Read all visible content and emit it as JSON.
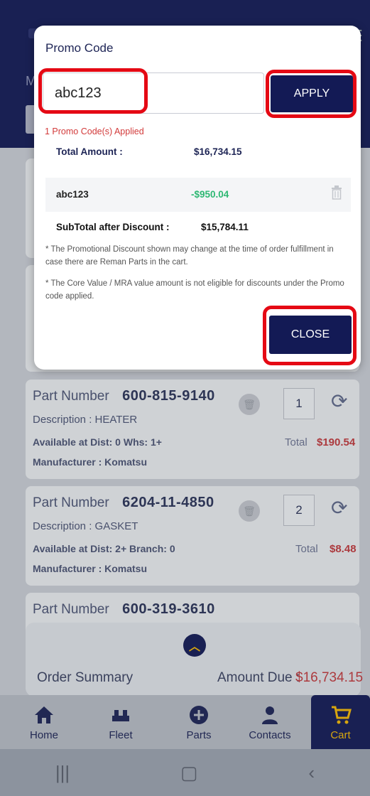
{
  "header": {
    "sub_letter": "M",
    "menu_icon": "hamburger-icon"
  },
  "parts": [
    {
      "pn_label": "Part Number",
      "pn": "600-815-9140",
      "desc": "Description :  HEATER",
      "avail": "Available at  Dist: 0  Whs: 1+",
      "mfr": "Manufacturer :  Komatsu",
      "qty": "1",
      "total_label": "Total",
      "total": "$190.54"
    },
    {
      "pn_label": "Part Number",
      "pn": "6204-11-4850",
      "desc": "Description :  GASKET",
      "avail": "Available at  Dist: 2+  Branch: 0",
      "mfr": "Manufacturer :  Komatsu",
      "qty": "2",
      "total_label": "Total",
      "total": "$8.48"
    },
    {
      "pn_label": "Part Number",
      "pn": "600-319-3610"
    }
  ],
  "summary": {
    "label": "Order Summary",
    "amount_due_label": "Amount Due :",
    "amount_due": "$16,734.15"
  },
  "nav": [
    {
      "label": "Home",
      "icon": "home-icon"
    },
    {
      "label": "Fleet",
      "icon": "fleet-icon"
    },
    {
      "label": "Parts",
      "icon": "plus-circle-icon"
    },
    {
      "label": "Contacts",
      "icon": "person-icon"
    },
    {
      "label": "Cart",
      "icon": "cart-icon"
    }
  ],
  "modal": {
    "title": "Promo Code",
    "promo_input_value": "abc123",
    "apply_label": "APPLY",
    "applied_msg": "1 Promo Code(s) Applied",
    "total_amount_label": "Total Amount :",
    "total_amount": "$16,734.15",
    "code": "abc123",
    "code_discount": "-$950.04",
    "subtotal_label": "SubTotal after Discount :",
    "subtotal": "$15,784.11",
    "note1": "* The Promotional Discount shown may change at the time of order fulfillment in case there are Reman Parts in the cart.",
    "note2": "* The Core Value / MRA value amount is not eligible for discounts under the Promo code applied.",
    "close_label": "CLOSE"
  },
  "colors": {
    "navy": "#131a55",
    "accent": "#f2b705",
    "highlight": "#e50914",
    "price": "#c0393c",
    "discount": "#2eb873"
  }
}
